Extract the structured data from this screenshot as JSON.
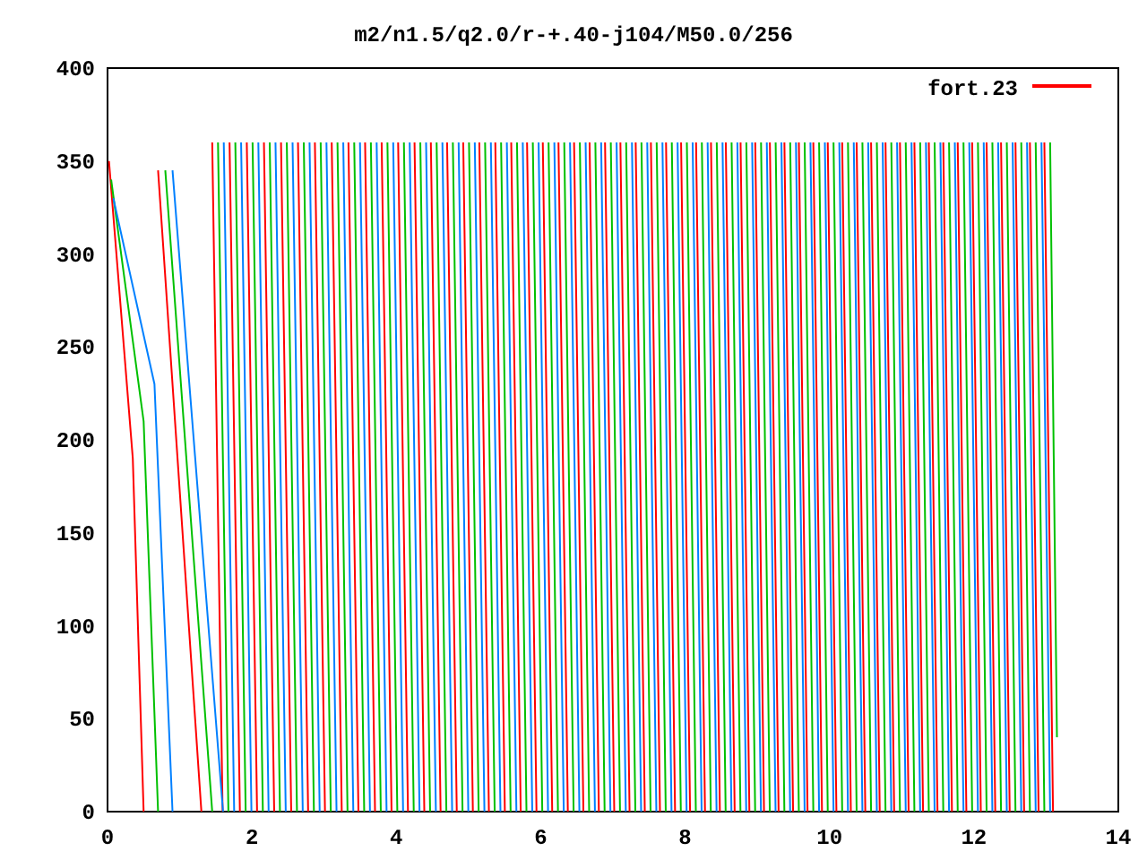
{
  "title": "m2/n1.5/q2.0/r-+.40-j104/M50.0/256",
  "y_ticks": [
    "400",
    "350",
    "300",
    "250",
    "200",
    "150",
    "100",
    "50",
    "0"
  ],
  "x_ticks": [
    "0",
    "2",
    "4",
    "6",
    "8",
    "10",
    "12",
    "14"
  ],
  "legend": {
    "label": "fort.23",
    "color": "#ff0000"
  }
}
